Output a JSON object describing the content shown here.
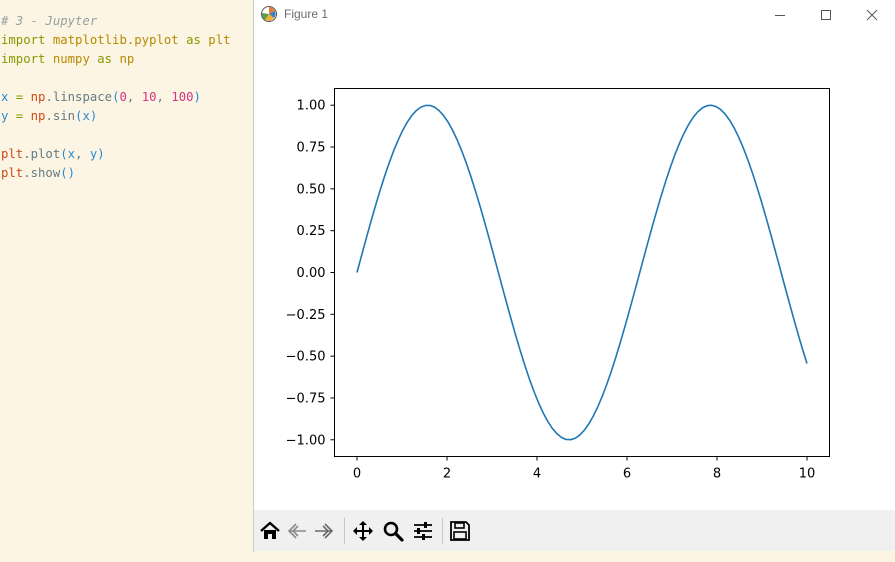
{
  "editor": {
    "lines": [
      [
        {
          "t": "# 3 - Jupyter",
          "c": "tok-comment"
        }
      ],
      [
        {
          "t": "import",
          "c": "tok-kw"
        },
        {
          "t": " matplotlib.pyplot ",
          "c": "tok-mod"
        },
        {
          "t": "as",
          "c": "tok-kw"
        },
        {
          "t": " plt",
          "c": "tok-mod"
        }
      ],
      [
        {
          "t": "import",
          "c": "tok-kw"
        },
        {
          "t": " numpy ",
          "c": "tok-mod"
        },
        {
          "t": "as",
          "c": "tok-kw"
        },
        {
          "t": " np",
          "c": "tok-mod"
        }
      ],
      [],
      [
        {
          "t": "x",
          "c": "tok-var"
        },
        {
          "t": " = ",
          "c": "tok-op"
        },
        {
          "t": "np",
          "c": "tok-obj"
        },
        {
          "t": ".linspace",
          "c": "tok-fn"
        },
        {
          "t": "(",
          "c": "tok-paren"
        },
        {
          "t": "0",
          "c": "tok-num"
        },
        {
          "t": ", ",
          "c": "tok-fn"
        },
        {
          "t": "10",
          "c": "tok-num"
        },
        {
          "t": ", ",
          "c": "tok-fn"
        },
        {
          "t": "100",
          "c": "tok-num"
        },
        {
          "t": ")",
          "c": "tok-paren"
        }
      ],
      [
        {
          "t": "y",
          "c": "tok-var"
        },
        {
          "t": " = ",
          "c": "tok-op"
        },
        {
          "t": "np",
          "c": "tok-obj"
        },
        {
          "t": ".sin",
          "c": "tok-fn"
        },
        {
          "t": "(",
          "c": "tok-paren"
        },
        {
          "t": "x",
          "c": "tok-var"
        },
        {
          "t": ")",
          "c": "tok-paren"
        }
      ],
      [],
      [
        {
          "t": "plt",
          "c": "tok-obj"
        },
        {
          "t": ".plot",
          "c": "tok-fn"
        },
        {
          "t": "(",
          "c": "tok-paren"
        },
        {
          "t": "x",
          "c": "tok-var"
        },
        {
          "t": ", ",
          "c": "tok-fn"
        },
        {
          "t": "y",
          "c": "tok-var"
        },
        {
          "t": ")",
          "c": "tok-paren"
        }
      ],
      [
        {
          "t": "plt",
          "c": "tok-obj"
        },
        {
          "t": ".show",
          "c": "tok-fn"
        },
        {
          "t": "()",
          "c": "tok-paren"
        }
      ]
    ]
  },
  "window": {
    "title": "Figure 1",
    "app_icon": "matplotlib-icon",
    "controls": [
      "minimize-icon",
      "maximize-icon",
      "close-icon"
    ]
  },
  "toolbar": {
    "buttons": [
      "home-icon",
      "back-icon",
      "forward-icon",
      "pan-icon",
      "zoom-icon",
      "configure-subplots-icon",
      "save-icon"
    ]
  },
  "chart_data": {
    "type": "line",
    "function": "sin",
    "x_start": 0,
    "x_end": 10,
    "num_points": 100,
    "xlim": [
      -0.5,
      10.5
    ],
    "ylim": [
      -1.1,
      1.1
    ],
    "xticks": [
      0,
      2,
      4,
      6,
      8,
      10
    ],
    "xtick_labels": [
      "0",
      "2",
      "4",
      "6",
      "8",
      "10"
    ],
    "yticks": [
      1.0,
      0.75,
      0.5,
      0.25,
      0.0,
      -0.25,
      -0.5,
      -0.75,
      -1.0
    ],
    "ytick_labels": [
      "1.00",
      "0.75",
      "0.50",
      "0.25",
      "0.00",
      "−0.25",
      "−0.50",
      "−0.75",
      "−1.00"
    ],
    "line_color": "#1f77b4",
    "grid": false,
    "title": "",
    "xlabel": "",
    "ylabel": ""
  }
}
